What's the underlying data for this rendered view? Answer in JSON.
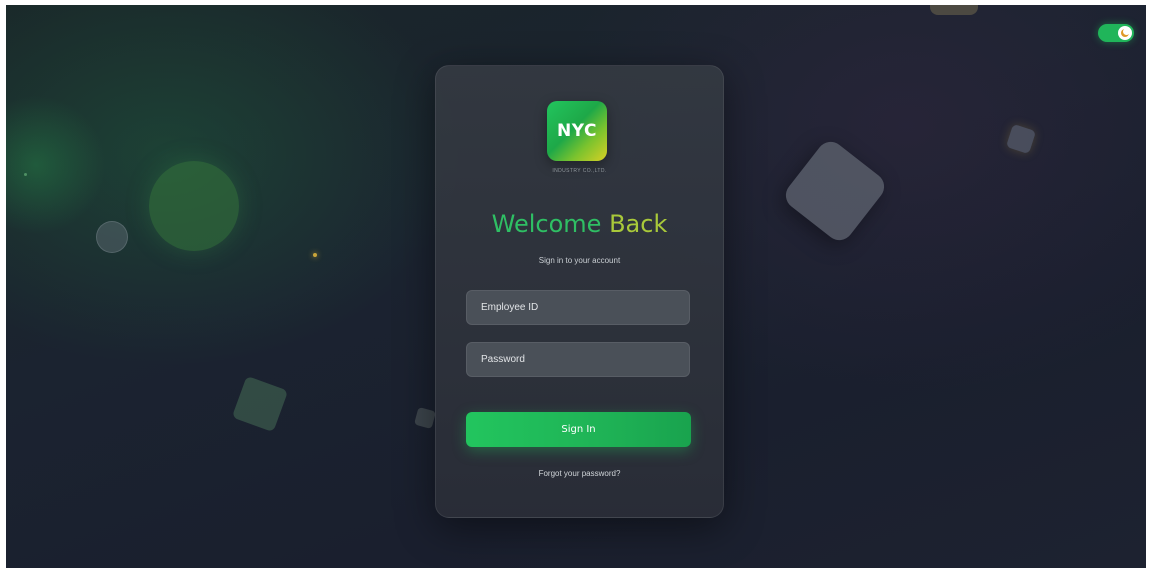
{
  "brand": {
    "logo_text": "NYC",
    "logo_subtext": "INDUSTRY CO.,LTD."
  },
  "login": {
    "title_part1": "Welcome",
    "title_part2": "Back",
    "subtitle": "Sign in to your account",
    "employee_id_placeholder": "Employee ID",
    "password_placeholder": "Password",
    "signin_label": "Sign In",
    "forgot_label": "Forgot your password?"
  },
  "theme_toggle": {
    "state": "on",
    "icon": "moon-icon"
  },
  "colors": {
    "accent": "#22c55e",
    "accent_secondary": "#a9c93a",
    "card_bg": "#343a42",
    "field_bg": "#4a5058"
  }
}
